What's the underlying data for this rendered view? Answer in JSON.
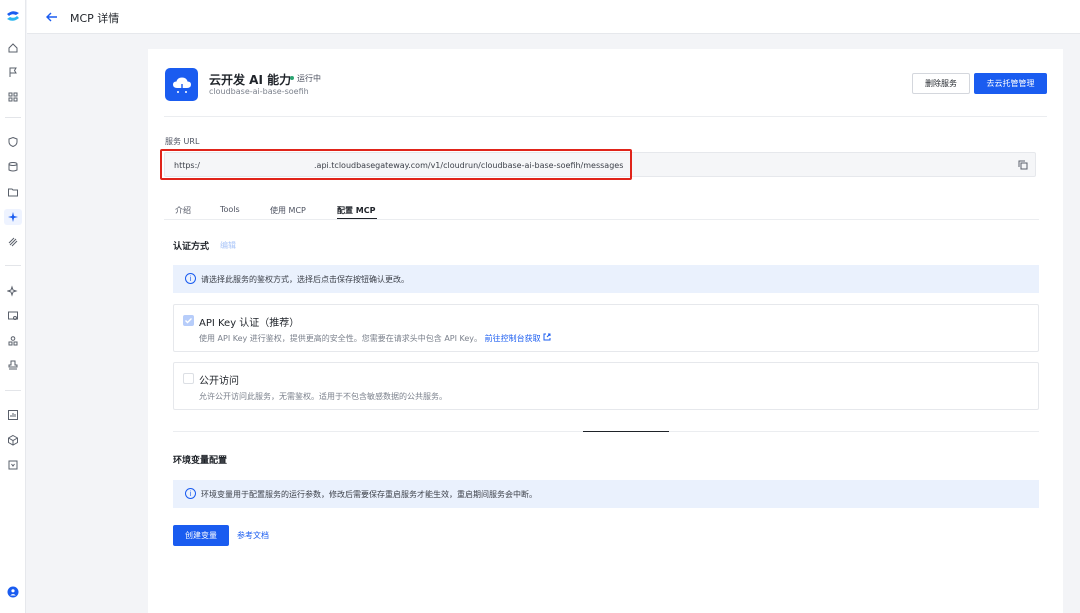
{
  "header": {
    "title": "MCP 详情"
  },
  "service": {
    "name": "云开发 AI 能力",
    "status": "运行中",
    "id": "cloudbase-ai-base-soefih"
  },
  "actions": {
    "delete_label": "删除服务",
    "manage_label": "去云托管管理"
  },
  "url": {
    "label": "服务 URL",
    "prefix": "https:/",
    "rest": ".api.tcloudbasegateway.com/v1/cloudrun/cloudbase-ai-base-soefih/messages"
  },
  "tabs": [
    {
      "label": "介绍"
    },
    {
      "label": "Tools"
    },
    {
      "label": "使用 MCP"
    },
    {
      "label": "配置 MCP",
      "active": true
    }
  ],
  "auth": {
    "title": "认证方式",
    "edit_label": "编辑",
    "info": "请选择此服务的鉴权方式，选择后点击保存按钮确认更改。",
    "options": [
      {
        "title": "API Key 认证（推荐）",
        "desc": "使用 API Key 进行鉴权，提供更高的安全性。您需要在请求头中包含 API Key。",
        "link": "前往控制台获取",
        "checked": true
      },
      {
        "title": "公开访问",
        "desc": "允许公开访问此服务，无需鉴权。适用于不包含敏感数据的公共服务。",
        "checked": false
      }
    ]
  },
  "env": {
    "title": "环境变量配置",
    "info": "环境变量用于配置服务的运行参数，修改后需要保存重启服务才能生效，重启期间服务会中断。",
    "create_label": "创建变量",
    "doc_label": "参考文档"
  },
  "colors": {
    "accent": "#1a5cf0",
    "status": "#2ba471",
    "highlight": "#e0241a"
  }
}
